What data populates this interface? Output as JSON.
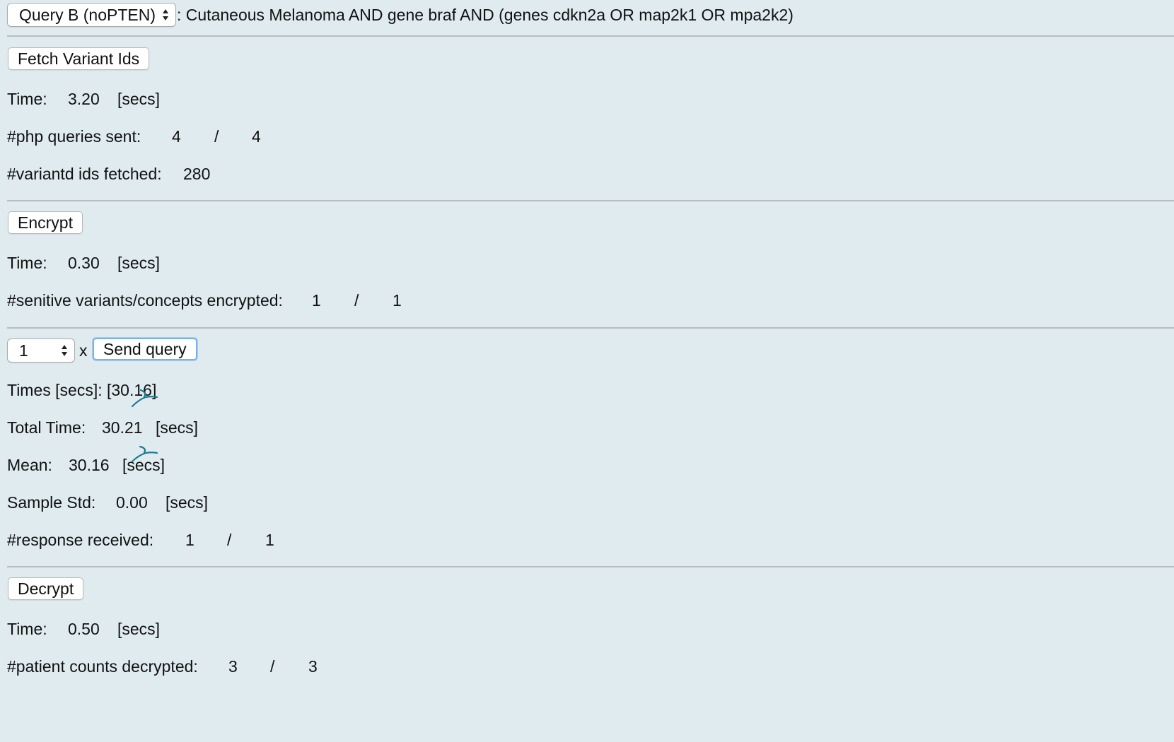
{
  "query": {
    "selected": "Query B (noPTEN)",
    "description": ": Cutaneous Melanoma AND gene braf AND (genes cdkn2a OR map2k1 OR mpa2k2)"
  },
  "fetch": {
    "button": "Fetch Variant Ids",
    "time_label": "Time:",
    "time_value": "3.20",
    "time_unit": "[secs]",
    "php_label": "#php queries sent:",
    "php_sent": "4",
    "php_sep": "/",
    "php_total": "4",
    "ids_label": "#variantd ids fetched:",
    "ids_value": "280"
  },
  "encrypt": {
    "button": "Encrypt",
    "time_label": "Time:",
    "time_value": "0.30",
    "time_unit": "[secs]",
    "sens_label": "#senitive variants/concepts encrypted:",
    "sens_done": "1",
    "sens_sep": "/",
    "sens_total": "1"
  },
  "send": {
    "count_selected": "1",
    "times_sign": "x",
    "button": "Send query",
    "times_label": "Times [secs]: [30.16]",
    "total_label": "Total Time:",
    "total_value": "30.21",
    "total_unit": "[secs]",
    "mean_label": "Mean:",
    "mean_value": "30.16",
    "mean_unit": "[secs]",
    "std_label": "Sample Std:",
    "std_value": "0.00",
    "std_unit": "[secs]",
    "resp_label": "#response received:",
    "resp_done": "1",
    "resp_sep": "/",
    "resp_total": "1"
  },
  "decrypt": {
    "button": "Decrypt",
    "time_label": "Time:",
    "time_value": "0.50",
    "time_unit": "[secs]",
    "counts_label": "#patient counts decrypted:",
    "counts_done": "3",
    "counts_sep": "/",
    "counts_total": "3"
  },
  "colors": {
    "background": "#e0ebf0",
    "divider": "#b8bcbe",
    "focus_ring": "#7cb2e8",
    "scribble": "#1f7a8c"
  }
}
